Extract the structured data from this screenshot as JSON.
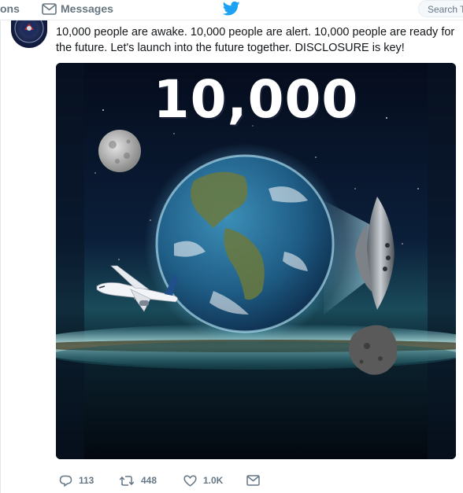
{
  "nav": {
    "notifications_label": "ons",
    "messages_label": "Messages",
    "search_placeholder": "Search T"
  },
  "tweet": {
    "text": "10,000 people are awake. 10,000 people are alert. 10,000 people are ready for the future. Let's launch into the future together. DISCLOSURE is key!",
    "media_headline": "10,000",
    "actions": {
      "replies": "113",
      "retweets": "448",
      "likes": "1.0K"
    }
  },
  "colors": {
    "twitter_blue": "#1da1f2",
    "action_gray": "#657786"
  },
  "icons": [
    "envelope-icon",
    "twitter-bird-icon",
    "reply-icon",
    "retweet-icon",
    "heart-icon",
    "direct-message-icon"
  ]
}
